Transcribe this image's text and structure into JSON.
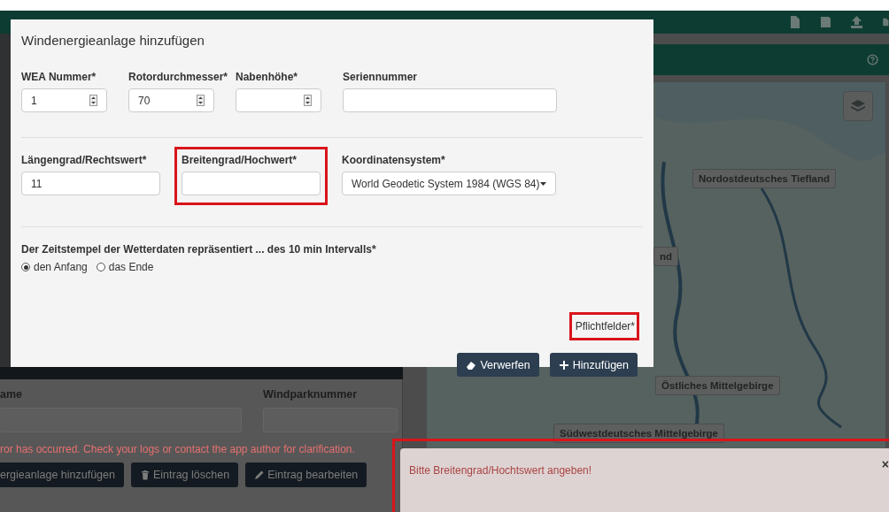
{
  "modal": {
    "title": "Windenergieanlage hinzufügen",
    "row_1": [
      {
        "label": "WEA Nummer*",
        "value": "1",
        "kind": "number"
      },
      {
        "label": "Rotordurchmesser*",
        "value": "70",
        "kind": "number"
      },
      {
        "label": "Nabenhöhe*",
        "kind": "number"
      },
      {
        "label": "Seriennummer",
        "kind": "text"
      }
    ],
    "row_2": [
      {
        "label": "Längengrad/Rechtswert*",
        "value": "11",
        "kind": "text",
        "highlighted": false
      },
      {
        "label": "Breitengrad/Hochwert*",
        "kind": "text",
        "highlighted": true
      },
      {
        "label": "Koordinatensystem*",
        "value": "World Geodetic System 1984 (WGS 84)",
        "kind": "select",
        "highlighted": false
      }
    ],
    "timestamp": {
      "label": "Der Zeitstempel der Wetterdaten repräsentiert ... des 10 min Intervalls*",
      "options": [
        {
          "label": "den Anfang",
          "selected": true
        },
        {
          "label": "das Ende",
          "selected": false
        }
      ]
    },
    "required_note": {
      "text": "Pflichtfelder*",
      "highlighted": true
    },
    "buttons": [
      {
        "label": "Verwerfen",
        "kind": "discard"
      },
      {
        "label": "Hinzufügen",
        "kind": "add"
      }
    ]
  },
  "background_form": {
    "fields": [
      {
        "label": "ame"
      },
      {
        "label": "Windparknummer"
      }
    ],
    "error": "ror has occurred. Check your logs or contact the app author for clarification.",
    "buttons": [
      {
        "label": "ergieanlage hinzufügen",
        "kind": "plain"
      },
      {
        "label": "Eintrag löschen",
        "kind": "delete"
      },
      {
        "label": "Eintrag bearbeiten",
        "kind": "edit"
      }
    ]
  },
  "map": {
    "region_labels": [
      "Nordostdeutsches Tiefland",
      "nd",
      "Östliches Mittelgebirge",
      "Südwestdeutsches Mittelgebirge"
    ]
  },
  "toast": {
    "message": "Bitte Breitengrad/Hochtswert angeben!",
    "close": "×",
    "highlighted": true
  }
}
